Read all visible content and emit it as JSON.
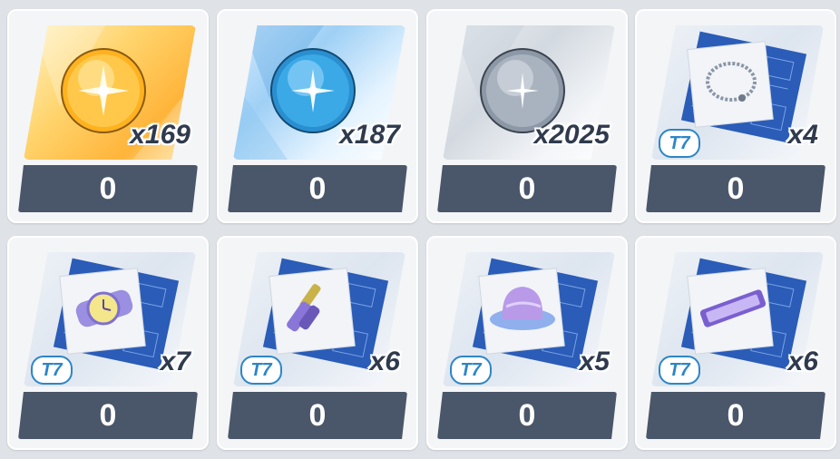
{
  "items": [
    {
      "name": "gold-sphere",
      "kind": "sphere",
      "theme": "gold",
      "quantity": "x169",
      "tier": "",
      "count": "0",
      "icon": "gold-sphere-icon"
    },
    {
      "name": "blue-sphere",
      "kind": "sphere",
      "theme": "blue",
      "quantity": "x187",
      "tier": "",
      "count": "0",
      "icon": "blue-sphere-icon"
    },
    {
      "name": "silver-sphere",
      "kind": "sphere",
      "theme": "silver",
      "quantity": "x2025",
      "tier": "",
      "count": "0",
      "icon": "silver-sphere-icon"
    },
    {
      "name": "bracelet-blueprint",
      "kind": "equip",
      "theme": "equip",
      "quantity": "x4",
      "tier": "T7",
      "count": "0",
      "icon": "bracelet-blueprint-icon"
    },
    {
      "name": "watch-blueprint",
      "kind": "equip",
      "theme": "equip",
      "quantity": "x7",
      "tier": "T7",
      "count": "0",
      "icon": "watch-blueprint-icon"
    },
    {
      "name": "hairpin-blueprint",
      "kind": "equip",
      "theme": "equip",
      "quantity": "x6",
      "tier": "T7",
      "count": "0",
      "icon": "hairpin-blueprint-icon"
    },
    {
      "name": "hat-blueprint",
      "kind": "equip",
      "theme": "equip",
      "quantity": "x5",
      "tier": "T7",
      "count": "0",
      "icon": "hat-blueprint-icon"
    },
    {
      "name": "badge-blueprint",
      "kind": "equip",
      "theme": "equip",
      "quantity": "x6",
      "tier": "T7",
      "count": "0",
      "icon": "badge-blueprint-icon"
    }
  ],
  "colors": {
    "count_bar": "#4a5669",
    "tier_blue": "#2d86c7",
    "blueprint_blue": "#2a5cb8",
    "gold_orb": "#ffb21f",
    "blue_orb": "#3aa9e6",
    "silver_orb": "#9aa6b2"
  }
}
